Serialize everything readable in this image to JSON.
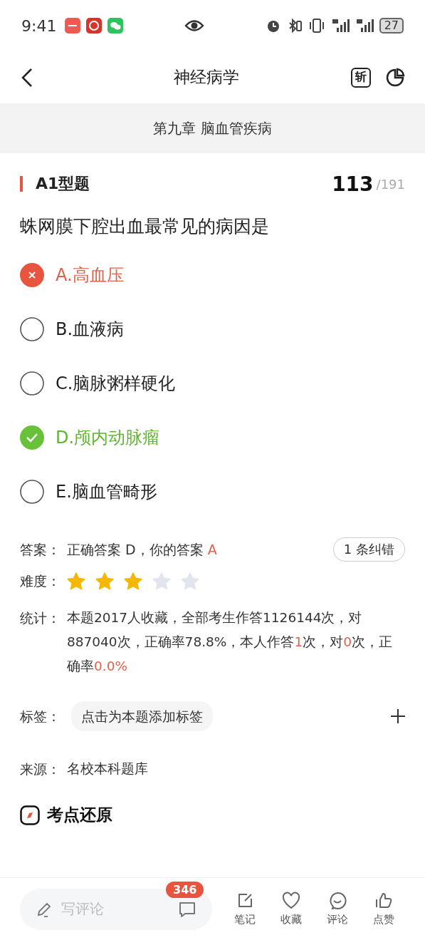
{
  "status_bar": {
    "time": "9:41",
    "battery": "27"
  },
  "header": {
    "title": "神经病学",
    "cut_button": "斩"
  },
  "chapter": "第九章 脑血管疾病",
  "question": {
    "type": "A1型题",
    "number": "113",
    "total": "/191",
    "stem": "蛛网膜下腔出血最常见的病因是",
    "options": [
      {
        "label": "A.高血压",
        "selected": true,
        "correct": false
      },
      {
        "label": "B.血液病",
        "selected": false,
        "correct": false
      },
      {
        "label": "C.脑脉粥样硬化",
        "selected": false,
        "correct": false
      },
      {
        "label": "D.颅内动脉瘤",
        "selected": false,
        "correct": true
      },
      {
        "label": "E.脑血管畸形",
        "selected": false,
        "correct": false
      }
    ]
  },
  "answer": {
    "label": "答案：",
    "segments": [
      {
        "text": "正确答案 D，你的答案 ",
        "highlight": false
      },
      {
        "text": "A",
        "highlight": true
      }
    ],
    "correction_button": "1 条纠错"
  },
  "difficulty": {
    "label": "难度：",
    "stars": 3
  },
  "stats": {
    "label": "统计：",
    "segments": [
      {
        "text": "本题2017人收藏，全部考生作答1126144次，对887040次，正确率78.8%，本人作答",
        "highlight": false
      },
      {
        "text": "1",
        "highlight": true
      },
      {
        "text": "次，对",
        "highlight": false
      },
      {
        "text": "0",
        "highlight": true
      },
      {
        "text": "次，正确率",
        "highlight": false
      },
      {
        "text": "0.0%",
        "highlight": true
      }
    ]
  },
  "tags": {
    "label": "标签：",
    "placeholder": "点击为本题添加标签"
  },
  "source": {
    "label": "来源：",
    "value": "名校本科题库"
  },
  "section": {
    "title": "考点还原"
  },
  "bottom_bar": {
    "comment_placeholder": "写评论",
    "comment_count": "346",
    "actions": [
      {
        "label": "笔记",
        "kind": "note"
      },
      {
        "label": "收藏",
        "kind": "favorite"
      },
      {
        "label": "评论",
        "kind": "comment"
      },
      {
        "label": "点赞",
        "kind": "like"
      }
    ]
  }
}
